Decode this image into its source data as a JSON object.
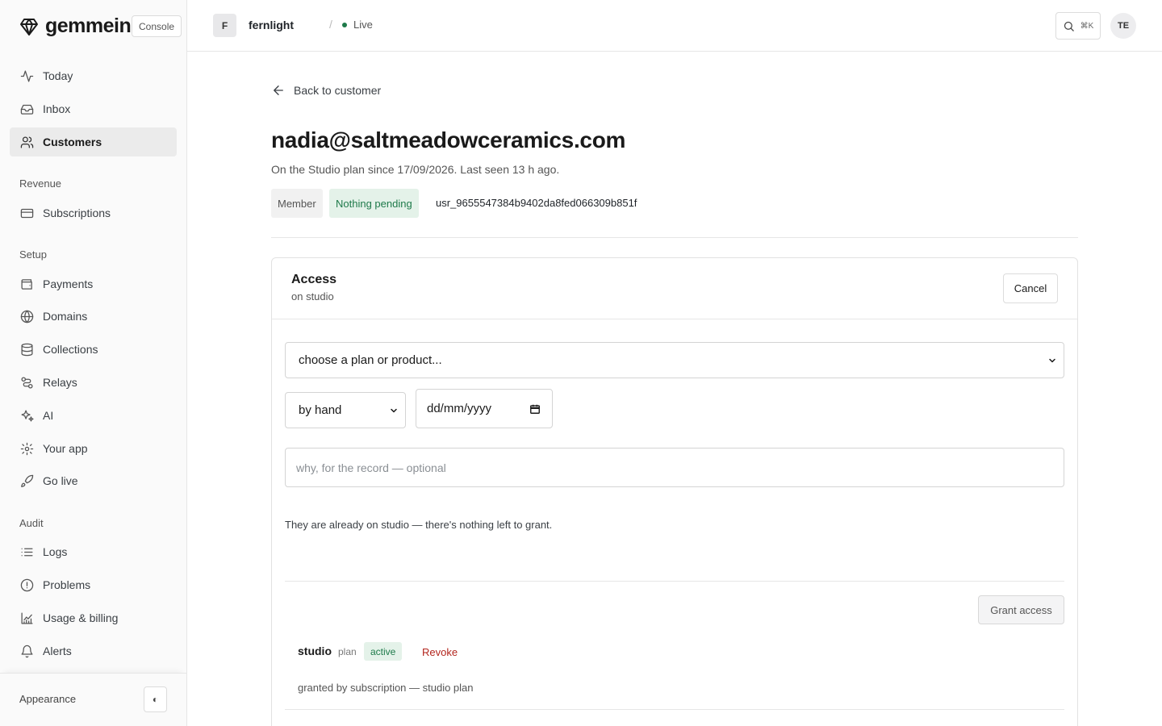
{
  "brand": {
    "name": "gemmein",
    "badge": "Console"
  },
  "sidebar": {
    "primary": [
      {
        "label": "Today",
        "icon": "activity-icon"
      },
      {
        "label": "Inbox",
        "icon": "inbox-icon"
      },
      {
        "label": "Customers",
        "icon": "users-icon",
        "active": true
      }
    ],
    "sections": [
      {
        "title": "Revenue",
        "items": [
          {
            "label": "Subscriptions",
            "icon": "credit-card-icon"
          }
        ]
      },
      {
        "title": "Setup",
        "items": [
          {
            "label": "Payments",
            "icon": "wallet-icon"
          },
          {
            "label": "Domains",
            "icon": "globe-icon"
          },
          {
            "label": "Collections",
            "icon": "database-icon"
          },
          {
            "label": "Relays",
            "icon": "route-icon"
          },
          {
            "label": "AI",
            "icon": "sparkles-icon"
          },
          {
            "label": "Your app",
            "icon": "gear-icon"
          },
          {
            "label": "Go live",
            "icon": "rocket-icon"
          }
        ]
      },
      {
        "title": "Audit",
        "items": [
          {
            "label": "Logs",
            "icon": "list-icon"
          },
          {
            "label": "Problems",
            "icon": "alert-circle-icon"
          },
          {
            "label": "Usage & billing",
            "icon": "chart-icon"
          },
          {
            "label": "Alerts",
            "icon": "bell-icon"
          }
        ]
      }
    ],
    "footer": {
      "appearance_label": "Appearance",
      "toggle_glyph": "◐"
    }
  },
  "topbar": {
    "project_initial": "F",
    "project_name": "fernlight",
    "separator": "/",
    "status": "Live",
    "search_shortcut": "⌘K",
    "user_initials": "TE"
  },
  "customer": {
    "back_label": "Back to customer",
    "email": "nadia@saltmeadowceramics.com",
    "summary": "On the Studio plan since 17/09/2026. Last seen 13 h ago.",
    "role_badge": "Member",
    "pending_badge": "Nothing pending",
    "user_id": "usr_9655547384b9402da8fed066309b851f"
  },
  "access_card": {
    "title": "Access",
    "subtitle": "on studio",
    "cancel_label": "Cancel",
    "plan_select_value": "choose a plan or product...",
    "method_select_value": "by hand",
    "date_placeholder": "dd/mm/yyyy",
    "reason_placeholder": "why, for the record — optional",
    "note": "They are already on studio — there's nothing left to grant.",
    "grant_label": "Grant access",
    "entitlement": {
      "name": "studio",
      "type": "plan",
      "status": "active",
      "revoke_label": "Revoke",
      "source": "granted by subscription — studio plan"
    }
  },
  "colors": {
    "accent_green": "#1e7a4a",
    "danger_red": "#b3261e",
    "active_nav_bg": "#ebebeb"
  }
}
